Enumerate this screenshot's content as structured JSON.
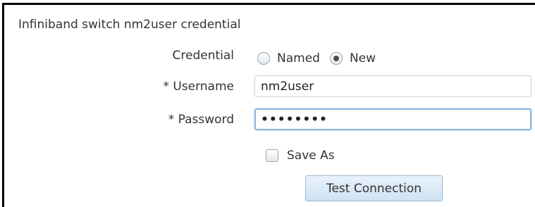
{
  "section": {
    "title": "Infiniband switch nm2user credential"
  },
  "credential": {
    "label": "Credential",
    "options": [
      {
        "label": "Named",
        "selected": false
      },
      {
        "label": "New",
        "selected": true
      }
    ]
  },
  "username": {
    "label": "* Username",
    "value": "nm2user"
  },
  "password": {
    "label": "* Password",
    "masked_value": "••••••••"
  },
  "save_as": {
    "label": "Save As",
    "checked": false
  },
  "test_connection": {
    "label": "Test Connection"
  },
  "colors": {
    "frame_border": "#000000",
    "focus_border": "#86b7e0",
    "button_bg": "#cfe2f3",
    "text": "#333333"
  }
}
